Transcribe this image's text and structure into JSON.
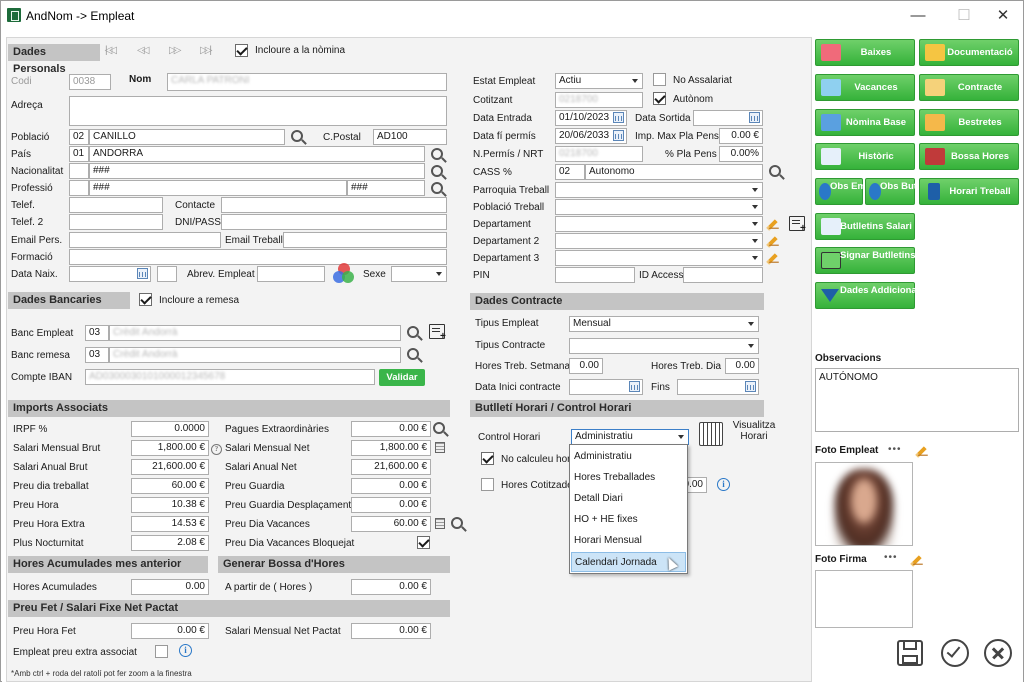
{
  "window": {
    "title": "AndNom -> Empleat",
    "minimize": "—",
    "maximize": "☐",
    "close": "✕"
  },
  "personal": {
    "section_title": "Dades Personals",
    "nav": {
      "first": "|◁◁",
      "prev": "◁◁",
      "next": "▷▷",
      "last": "▷▷|"
    },
    "include_payroll_label": "Incloure a la nòmina",
    "codi_label": "Codi",
    "codi_value": "0038",
    "nom_label": "Nom",
    "nom_value": "CARLA PATRONI",
    "adreca_label": "Adreça",
    "poblacio_label": "Població",
    "poblacio_code": "02",
    "poblacio_value": "CANILLO",
    "cpostal_label": "C.Postal",
    "cpostal_value": "AD100",
    "pais_label": "País",
    "pais_code": "01",
    "pais_value": "ANDORRA",
    "nacionalitat_label": "Nacionalitat",
    "nacionalitat_value": "###",
    "professio_label": "Professió",
    "professio_value": "###",
    "professio_value2": "###",
    "telef_label": "Telef.",
    "contacte_label": "Contacte",
    "telef2_label": "Telef. 2",
    "dnipass_label": "DNI/PASS",
    "email_pers_label": "Email Pers.",
    "email_treball_label": "Email Treball",
    "formacio_label": "Formació",
    "data_naix_label": "Data Naix.",
    "abrev_label": "Abrev. Empleat",
    "sexe_label": "Sexe"
  },
  "employee": {
    "estat_label": "Estat Empleat",
    "estat_value": "Actiu",
    "no_assalariat_label": "No Assalariat",
    "cotitzant_label": "Cotitzant",
    "cotitzant_value": "0218700",
    "autonom_label": "Autònom",
    "data_entrada_label": "Data Entrada",
    "data_entrada_value": "01/10/2023",
    "data_sortida_label": "Data Sortida",
    "data_permis_label": "Data fí permís",
    "data_permis_value": "20/06/2033",
    "imp_max_label": "Imp. Max Pla Pens",
    "imp_max_value": "0.00 €",
    "npermis_label": "N.Permís / NRT",
    "npermis_value": "0218700",
    "pla_pens_label": "% Pla Pens",
    "pla_pens_value": "0.00%",
    "cass_label": "CASS %",
    "cass_code": "02",
    "cass_value": "Autonomo",
    "parroquia_label": "Parroquia Treball",
    "poblacio_treball_label": "Població Treball",
    "departament_label": "Departament",
    "departament2_label": "Departament 2",
    "departament3_label": "Departament 3",
    "pin_label": "PIN",
    "id_access_label": "ID Access"
  },
  "bank": {
    "section_title": "Dades Bancaries",
    "include_label": "Incloure a remesa",
    "banc_empleat_label": "Banc Empleat",
    "banc_empleat_code": "03",
    "banc_empleat_value": "Crèdit Andorrà",
    "banc_remesa_label": "Banc remesa",
    "banc_remesa_code": "03",
    "banc_remesa_value": "Crèdit Andorrà",
    "iban_label": "Compte IBAN",
    "iban_value": "AD0300030101000012345678",
    "validar_label": "Validar"
  },
  "contract": {
    "section_title": "Dades Contracte",
    "tipus_empleat_label": "Tipus Empleat",
    "tipus_empleat_value": "Mensual",
    "tipus_contracte_label": "Tipus Contracte",
    "hores_setmana_label": "Hores Treb. Setmana",
    "hores_setmana_value": "0.00",
    "hores_dia_label": "Hores Treb. Dia",
    "hores_dia_value": "0.00",
    "data_inici_label": "Data Inici contracte",
    "fins_label": "Fins"
  },
  "imports": {
    "section_title": "Imports Associats",
    "left": [
      {
        "label": "IRPF %",
        "value": "0.0000"
      },
      {
        "label": "Salari Mensual Brut",
        "value": "1,800.00 €"
      },
      {
        "label": "Salari Anual Brut",
        "value": "21,600.00 €"
      },
      {
        "label": "Preu dia treballat",
        "value": "60.00 €"
      },
      {
        "label": "Preu Hora",
        "value": "10.38 €"
      },
      {
        "label": "Preu Hora Extra",
        "value": "14.53 €"
      },
      {
        "label": "Plus Nocturnitat",
        "value": "2.08 €"
      }
    ],
    "right": [
      {
        "label": "Pagues Extraordinàries",
        "value": "0.00 €"
      },
      {
        "label": "Salari Mensual Net",
        "value": "1,800.00 €"
      },
      {
        "label": "Salari Anual Net",
        "value": "21,600.00 €"
      },
      {
        "label": "Preu Guardia",
        "value": "0.00 €"
      },
      {
        "label": "Preu Guardia Desplaçament",
        "value": "0.00 €"
      },
      {
        "label": "Preu Dia Vacances",
        "value": "60.00 €"
      }
    ],
    "vac_bloq_label": "Preu Dia Vacances Bloquejat"
  },
  "hours": {
    "section_title": "Hores Acumulades mes anterior",
    "acum_label": "Hores Acumulades",
    "acum_value": "0.00",
    "bossa_title": "Generar Bossa d'Hores",
    "apartir_label": "A partir de ( Hores )",
    "apartir_value": "0.00 €"
  },
  "fixed": {
    "section_title": "Preu Fet / Salari Fixe Net Pactat",
    "preu_hora_label": "Preu Hora Fet",
    "preu_hora_value": "0.00 €",
    "salari_pactat_label": "Salari Mensual Net Pactat",
    "salari_pactat_value": "0.00 €",
    "extra_label": "Empleat preu extra associat"
  },
  "schedule": {
    "section_title": "Butlletí Horari / Control Horari",
    "control_label": "Control Horari",
    "control_value": "Administratiu",
    "visualitza_label": "Visualitza Horari",
    "no_calc_label": "No calculeu hore",
    "hores_cot_label": "Hores Cotitzade",
    "hores_cot_value": "0.00",
    "options": [
      "Administratiu",
      "Hores Treballades",
      "Detall Diari",
      "HO + HE fixes",
      "Horari Mensual",
      "Calendari Jornada"
    ]
  },
  "footer": {
    "hint": "*Amb ctrl + roda del ratolí pot fer zoom a la finestra"
  },
  "sidebar": {
    "buttons": {
      "baixes": "Baixes",
      "documentacio": "Documentació",
      "vacances": "Vacances",
      "contracte": "Contracte",
      "nomina_base": "Nòmina Base",
      "bestretes": "Bestretes",
      "historic": "Històric",
      "bossa_hores": "Bossa Hores",
      "obs_empl": "Obs Empl",
      "obs_butlleti": "Obs Butlleti",
      "horari_treball": "Horari Treball",
      "butlletins_salari": "Butlletins Salari",
      "signar_butlletins": "Signar Butlletins",
      "dades_addicionals": "Dades Addicionals"
    },
    "observacions_label": "Observacions",
    "observacions_value": "AUTÓNOMO",
    "foto_empleat_label": "Foto Empleat",
    "foto_firma_label": "Foto Firma",
    "more_dots": "•••"
  },
  "colors": {
    "accent_green": "#35b23a",
    "section_gray": "#c4c4c4",
    "highlight": "#cce4f7"
  }
}
